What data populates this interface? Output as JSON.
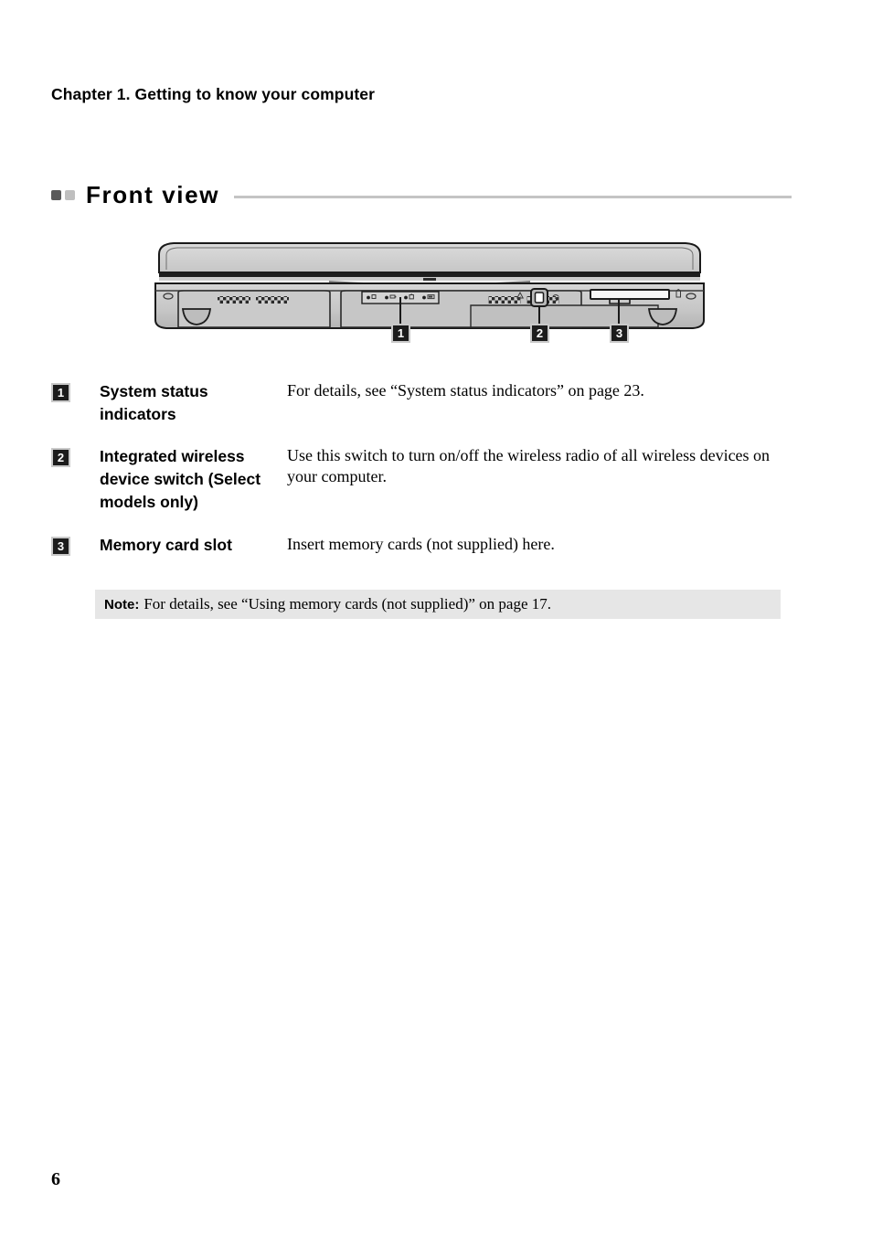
{
  "page": {
    "chapter_heading": "Chapter 1. Getting to know your computer",
    "section_title": "Front view",
    "folio": "6"
  },
  "illustration": {
    "alt_name": "laptop-front-view-diagram",
    "callouts": [
      {
        "number": "1",
        "target": "system-status-indicators"
      },
      {
        "number": "2",
        "target": "integrated-wireless-device-switch"
      },
      {
        "number": "3",
        "target": "memory-card-slot"
      }
    ],
    "indicator_count": 4
  },
  "items": [
    {
      "number": "1",
      "term": "System status indicators",
      "description": "For details, see “System status indicators” on page 23."
    },
    {
      "number": "2",
      "term": "Integrated wireless device switch (Select models only)",
      "description": "Use this switch to turn on/off the wireless radio of all wireless devices on your computer."
    },
    {
      "number": "3",
      "term": "Memory card slot",
      "description": "Insert memory cards (not supplied) here."
    }
  ],
  "note": {
    "label": "Note:",
    "text": "For details, see “Using memory cards (not supplied)” on page 17."
  },
  "colors": {
    "callout_background": "#1c1c1c",
    "callout_border": "#c9c9c9",
    "note_background": "#e6e6e6",
    "rule": "#c4c4c4",
    "bullet_dark": "#5a5a5a",
    "bullet_light": "#bfbfbf",
    "chassis_light": "#d2d2d2",
    "chassis_mid": "#c2c2c2",
    "chassis_dark": "#9e9e9e"
  }
}
